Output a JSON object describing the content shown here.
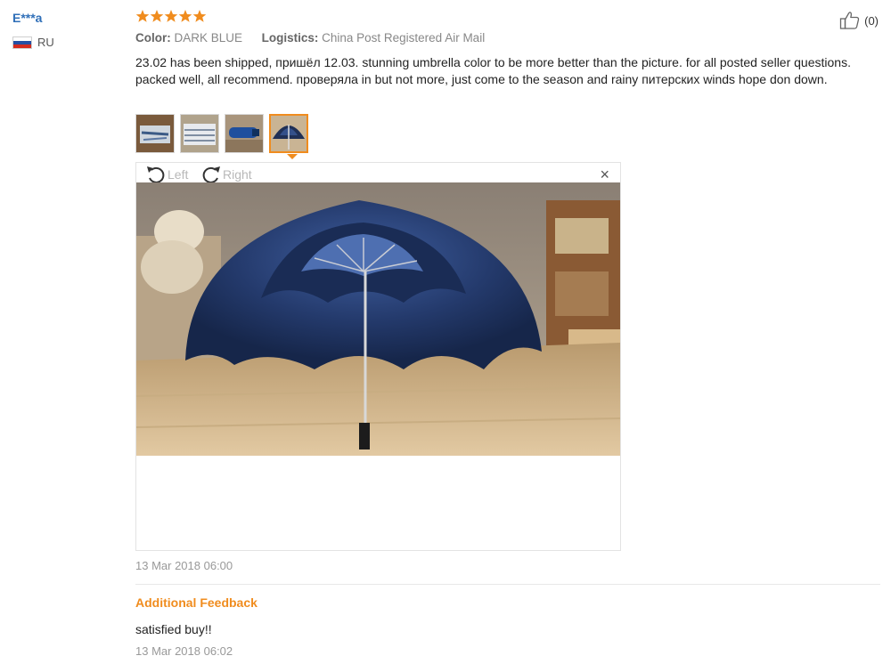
{
  "user": {
    "name": "E***a",
    "country": "RU",
    "flag_colors": [
      "#ffffff",
      "#2450a4",
      "#d52b1e"
    ]
  },
  "review": {
    "rating": 5,
    "max_rating": 5,
    "star_color": "#f08c1e",
    "color_label": "Color:",
    "color_value": "DARK BLUE",
    "logistics_label": "Logistics:",
    "logistics_value": "China Post Registered Air Mail",
    "text": "23.02 has been shipped, пришёл 12.03. stunning umbrella color to be more better than the picture. for all posted seller questions. packed well, all recommend. проверяла in but not more, just come to the season and rainy питерских winds hope don down.",
    "helpful_count": "(0)",
    "date": "13 Mar 2018 06:00"
  },
  "thumbnails": [
    {
      "name": "photo-1",
      "active": false
    },
    {
      "name": "photo-2",
      "active": false
    },
    {
      "name": "photo-3",
      "active": false
    },
    {
      "name": "photo-4",
      "active": true
    }
  ],
  "viewer": {
    "rotate_left_label": "Left",
    "rotate_right_label": "Right",
    "close_symbol": "×"
  },
  "additional_feedback": {
    "title": "Additional Feedback",
    "text": "satisfied buy!!",
    "date": "13 Mar 2018 06:02"
  },
  "colors": {
    "accent": "#f08c1e",
    "link": "#2f6fb8"
  },
  "icons": {
    "like": "thumbs-up-icon",
    "rotate_left": "rotate-left-icon",
    "rotate_right": "rotate-right-icon",
    "close": "close-icon"
  }
}
